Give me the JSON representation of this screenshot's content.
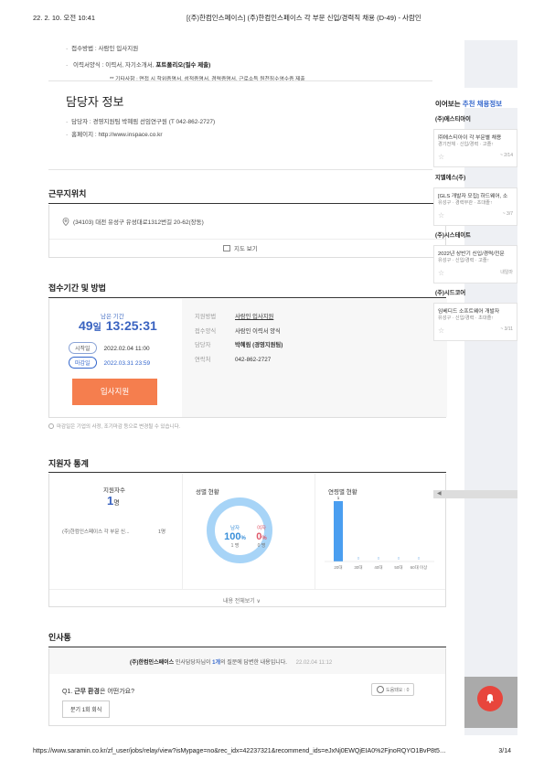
{
  "print": {
    "datetime": "22. 2. 10. 오전 10:41",
    "title": "[(주)한컴인스페이스] (주)한컴인스페이스 각 부문 신입/경력직 채용 (D-49) - 사람인",
    "url": "https://www.saramin.co.kr/zf_user/jobs/relay/view?isMypage=no&rec_idx=42237321&recommend_ids=eJxNj0EWQjEIA0%2FjnoRQYO1BvP8t5…",
    "page": "3/14"
  },
  "apply_method": {
    "line1": "접수방법 : 사람인 입사지원",
    "line2_prefix": "이력서양식 : 이력서, 자기소개서, ",
    "line2_bold": "포트폴리오(필수 제출)",
    "line3": "** 기타사항 : 면접 시 학위증명서, 성적증명서, 경력증명서, 근로소득 원천징수영수증 제출"
  },
  "contact": {
    "heading": "담당자 정보",
    "person": "담당자 : 경영지원팀 박혜림 선임연구원 (T 042-862-2727)",
    "homepage": "홈페이지 : http://www.inspace.co.kr"
  },
  "location": {
    "heading": "근무지위치",
    "address": "(34103) 대전 유성구 유성대로1312번길 20-62(장동)",
    "map_button": "지도 보기"
  },
  "period": {
    "heading": "접수기간 및 방법",
    "remaining_label": "남은 기간",
    "remaining_days": "49",
    "remaining_day_unit": "일",
    "remaining_time": "13:25:31",
    "start_tag": "시작일",
    "start_date": "2022.02.04 11:00",
    "end_tag": "마감일",
    "end_date": "2022.03.31 23:59",
    "apply_button": "입사지원",
    "notice": "마감일은 기업의 사정, 조기마감 등으로 변경될 수 있습니다.",
    "details": [
      {
        "label": "지원방법",
        "value": "사람인 입사지원"
      },
      {
        "label": "접수양식",
        "value": "사람인 이력서 양식"
      },
      {
        "label": "담당자",
        "value": "박혜림 (경영지원팀)"
      },
      {
        "label": "연락처",
        "value": "042-862-2727"
      }
    ]
  },
  "stats": {
    "heading": "지원자 통계",
    "applicants_label": "지원자수",
    "applicants_count": "1",
    "applicants_unit": "명",
    "job_row_name": "(주)한컴인스페이스 각 부문 신...",
    "job_row_count": "1명",
    "gender_heading": "성별 현황",
    "male_label": "남자",
    "male_pct": "100",
    "male_count": "1 명",
    "female_label": "여자",
    "female_pct": "0",
    "female_count": "0 명",
    "pct_unit": "%",
    "age_heading": "연령별 현황",
    "more_button": "내용 전체보기"
  },
  "chart_data": {
    "type": "bar",
    "categories": [
      "20대",
      "30대",
      "40대",
      "50대",
      "60대 이상"
    ],
    "values": [
      1,
      0,
      0,
      0,
      0
    ]
  },
  "talk": {
    "heading": "인사통",
    "notice_company": "(주)한컴인스페이스",
    "notice_mid": " 인사담당자님이 ",
    "notice_count": "1개",
    "notice_end": "의 질문에 답변한 내용입니다.",
    "notice_date": "22.02.04 11:12",
    "q_prefix": "Q1. ",
    "q_bold": "근무 환경",
    "q_rest": "은 어떤가요?",
    "answer_tag": "분기 1회 회식",
    "helpful": "도움돼요 : 0"
  },
  "sidebar": {
    "heading_prefix": "이어보는 ",
    "heading_accent": "추천 채용정보",
    "cards": [
      {
        "company": "(주)에스티아이",
        "title": "㈜에스티아이 각 부문별 채용",
        "meta": "경기전체 · 신입/경력 · 고졸↑",
        "date": "~ 2/14"
      },
      {
        "company": "지엘에스(주)",
        "title": "[GLS 개발자 모집] 하드웨어, 소",
        "meta": "유성구 · 경력무관 · 초대졸↑",
        "date": "~ 3/7"
      },
      {
        "company": "(주)시스테이트",
        "title": "2022년 상반기 신입/경력/전문",
        "meta": "유성구 · 신입/경력 · 고졸↑",
        "date": "내일마"
      },
      {
        "company": "(주)시드코어",
        "title": "임베디드 소프트웨어 개발자",
        "meta": "유성구 · 신입/경력 · 초대졸↑",
        "date": "~ 3/11"
      }
    ]
  }
}
